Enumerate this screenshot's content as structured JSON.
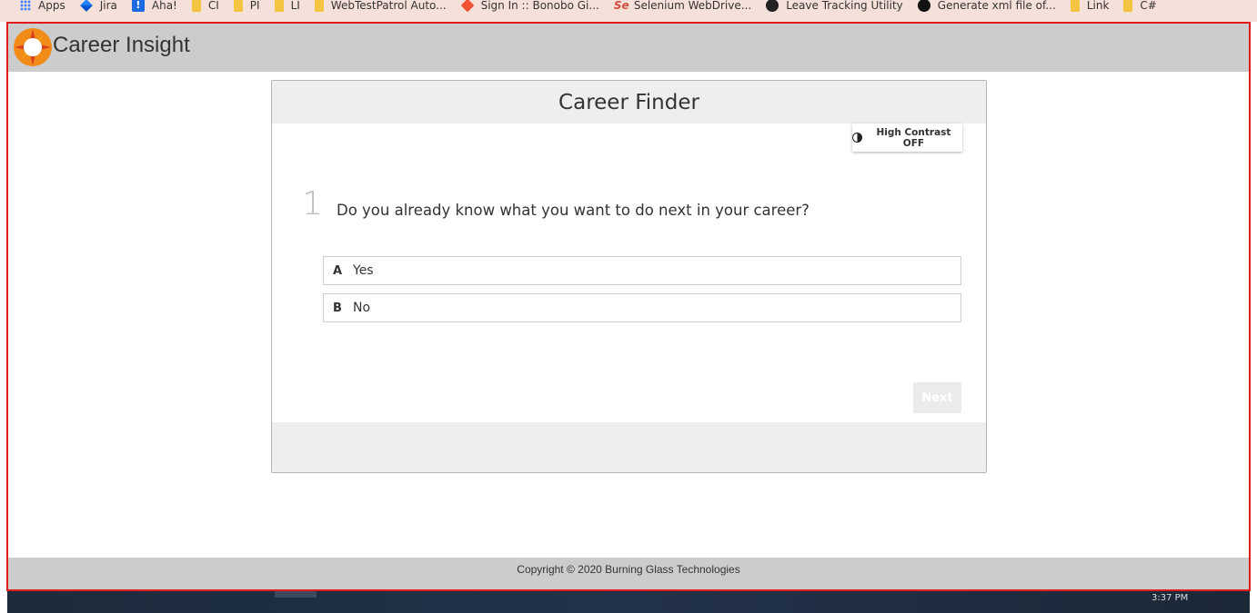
{
  "bookmarks": [
    {
      "label": "Apps",
      "icon": "apps-grid-icon"
    },
    {
      "label": "Jira",
      "icon": "jira-icon"
    },
    {
      "label": "Aha!",
      "icon": "aha-icon"
    },
    {
      "label": "CI",
      "icon": "folder-icon"
    },
    {
      "label": "PI",
      "icon": "folder-icon"
    },
    {
      "label": "LI",
      "icon": "folder-icon"
    },
    {
      "label": "WebTestPatrol Auto...",
      "icon": "folder-icon"
    },
    {
      "label": "Sign In :: Bonobo Gi...",
      "icon": "git-icon"
    },
    {
      "label": "Selenium WebDrive...",
      "icon": "selenium-icon"
    },
    {
      "label": "Leave Tracking Utility",
      "icon": "globe-icon"
    },
    {
      "label": "Generate xml file of...",
      "icon": "github-icon"
    },
    {
      "label": "Link",
      "icon": "folder-icon"
    },
    {
      "label": "C#",
      "icon": "folder-icon"
    }
  ],
  "header": {
    "app_title": "Career Insight"
  },
  "card": {
    "title": "Career Finder",
    "contrast_label": "High Contrast OFF",
    "question": {
      "number": "1",
      "text": "Do you already know what you want to do next in your career?"
    },
    "options": [
      {
        "letter": "A",
        "label": "Yes"
      },
      {
        "letter": "B",
        "label": "No"
      }
    ],
    "next_label": "Next"
  },
  "footer": {
    "copyright": "Copyright © 2020 Burning Glass Technologies"
  },
  "taskbar": {
    "clock": "3:37 PM"
  },
  "colors": {
    "frame_border": "#e01b1b",
    "header_bg": "#cccccc",
    "card_head_bg": "#eeeeee",
    "logo_orange": "#f28c18"
  }
}
